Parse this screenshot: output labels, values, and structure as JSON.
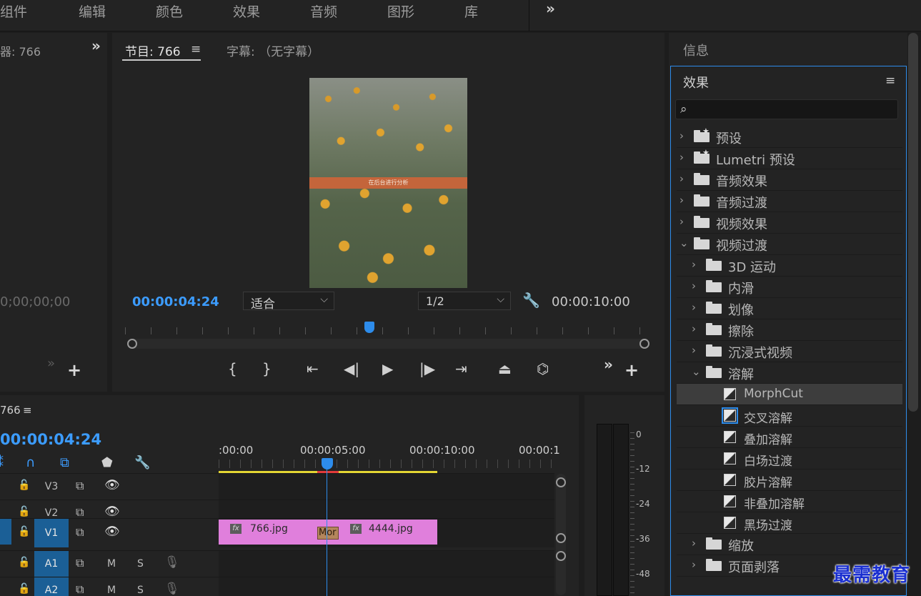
{
  "workspace": {
    "tabs": [
      "组件",
      "编辑",
      "颜色",
      "效果",
      "音频",
      "图形",
      "库"
    ],
    "more": "»"
  },
  "source_monitor": {
    "tab": "器: 766",
    "more": "»",
    "timecode": "0;00;00;00",
    "arrows": "»",
    "plus": "+"
  },
  "program_monitor": {
    "tab": "节目: 766",
    "menu": "≡",
    "caption_tab": "字幕: （无字幕）",
    "preview_text": "在后台进行分析",
    "timecode": "00:00:04:24",
    "fit": "适合",
    "resolution": "1/2",
    "duration": "00:00:10:00",
    "more": "»",
    "plus": "+",
    "playhead_position": 0.49
  },
  "timeline": {
    "sequence": "766",
    "menu": "≡",
    "timecode": "00:00:04:24",
    "ruler": [
      ":00:00",
      "00:00:05:00",
      "00:00:10:00",
      "00:00:1"
    ],
    "tracks": [
      {
        "name": "V3"
      },
      {
        "name": "V2"
      },
      {
        "name": "V1"
      },
      {
        "name": "A1",
        "m": "M",
        "s": "S"
      },
      {
        "name": "A2",
        "m": "M",
        "s": "S"
      }
    ],
    "clips": [
      {
        "name": "766.jpg"
      },
      {
        "name": "4444.jpg"
      }
    ],
    "transition_label": "Mor"
  },
  "audio_meter": {
    "db_labels": [
      "0",
      "-12",
      "-24",
      "-36",
      "-48"
    ]
  },
  "right_panel": {
    "info_tab": "信息",
    "effects_title": "效果",
    "menu": "≡",
    "search_placeholder": "",
    "tree": [
      {
        "label": "预设",
        "level": 0,
        "expanded": false,
        "star": true
      },
      {
        "label": "Lumetri 预设",
        "level": 0,
        "expanded": false,
        "star": true
      },
      {
        "label": "音频效果",
        "level": 0,
        "expanded": false
      },
      {
        "label": "音频过渡",
        "level": 0,
        "expanded": false
      },
      {
        "label": "视频效果",
        "level": 0,
        "expanded": false
      },
      {
        "label": "视频过渡",
        "level": 0,
        "expanded": true
      },
      {
        "label": "3D 运动",
        "level": 1,
        "expanded": false
      },
      {
        "label": "内滑",
        "level": 1,
        "expanded": false
      },
      {
        "label": "划像",
        "level": 1,
        "expanded": false
      },
      {
        "label": "擦除",
        "level": 1,
        "expanded": false
      },
      {
        "label": "沉浸式视频",
        "level": 1,
        "expanded": false
      },
      {
        "label": "溶解",
        "level": 1,
        "expanded": true
      },
      {
        "label": "MorphCut",
        "level": 2,
        "item": true,
        "highlighted": true
      },
      {
        "label": "交叉溶解",
        "level": 2,
        "item": true,
        "selected": true
      },
      {
        "label": "叠加溶解",
        "level": 2,
        "item": true
      },
      {
        "label": "白场过渡",
        "level": 2,
        "item": true
      },
      {
        "label": "胶片溶解",
        "level": 2,
        "item": true
      },
      {
        "label": "非叠加溶解",
        "level": 2,
        "item": true
      },
      {
        "label": "黑场过渡",
        "level": 2,
        "item": true
      },
      {
        "label": "缩放",
        "level": 1,
        "expanded": false
      },
      {
        "label": "页面剥落",
        "level": 1,
        "expanded": false
      }
    ]
  },
  "watermark": "最需教育",
  "colors": {
    "accent": "#2d8ceb",
    "timecode": "#3c9cff",
    "clip": "#e07fdc",
    "workarea": "#e3d533"
  }
}
